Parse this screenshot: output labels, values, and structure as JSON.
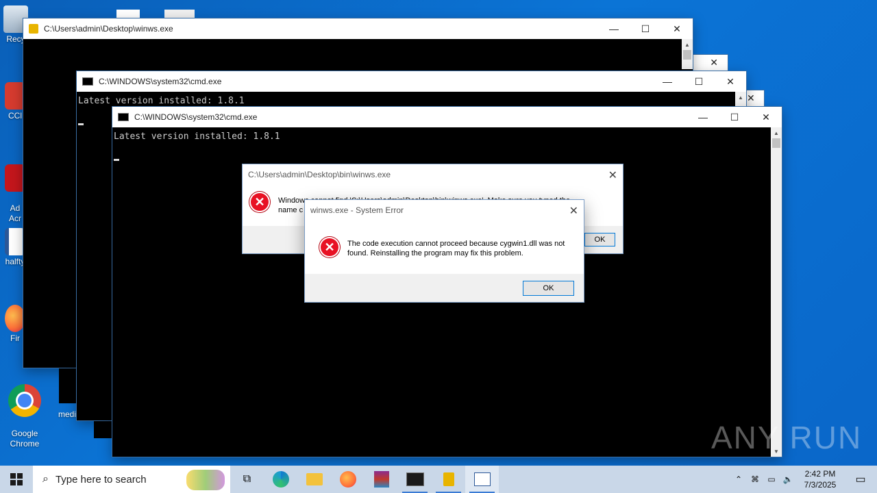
{
  "desktop": {
    "icons": [
      {
        "label": "Recy",
        "name": "recycle-bin"
      },
      {
        "label": "CCl",
        "name": "ccleaner"
      },
      {
        "label": "Ad\nAcr",
        "name": "adobe-acrobat"
      },
      {
        "label": "halfty",
        "name": "word-document"
      },
      {
        "label": "Fir",
        "name": "firefox"
      },
      {
        "label": "Google\nChrome",
        "name": "google-chrome"
      },
      {
        "label": "medi",
        "name": "media-file"
      }
    ]
  },
  "windows": {
    "winws_main": {
      "title": "C:\\Users\\admin\\Desktop\\winws.exe"
    },
    "cmd_back": {
      "title": "C:\\WINDOWS\\system32\\cmd.exe",
      "output": "Latest version installed: 1.8.1"
    },
    "cmd_front": {
      "title": "C:\\WINDOWS\\system32\\cmd.exe",
      "output": "Latest version installed: 1.8.1"
    }
  },
  "dialogs": {
    "cannot_find": {
      "title": "C:\\Users\\admin\\Desktop\\bin\\winws.exe",
      "message_line1": "Windows cannot find 'C:\\Users\\admin\\Desktop\\bin\\winws.exe'. Make sure you typed the",
      "message_line2": "name c",
      "ok_label": "OK"
    },
    "system_error": {
      "title": "winws.exe - System Error",
      "message": "The code execution cannot proceed because cygwin1.dll was not found. Reinstalling the program may fix this problem.",
      "ok_label": "OK"
    }
  },
  "taskbar": {
    "search_placeholder": "Type here to search",
    "time": "2:42 PM",
    "date": "7/3/2025"
  },
  "watermark": "ANY RUN",
  "colors": {
    "desktop": "#0a6ccf",
    "error_red": "#e81123",
    "taskbar": "#c9d7e8"
  }
}
